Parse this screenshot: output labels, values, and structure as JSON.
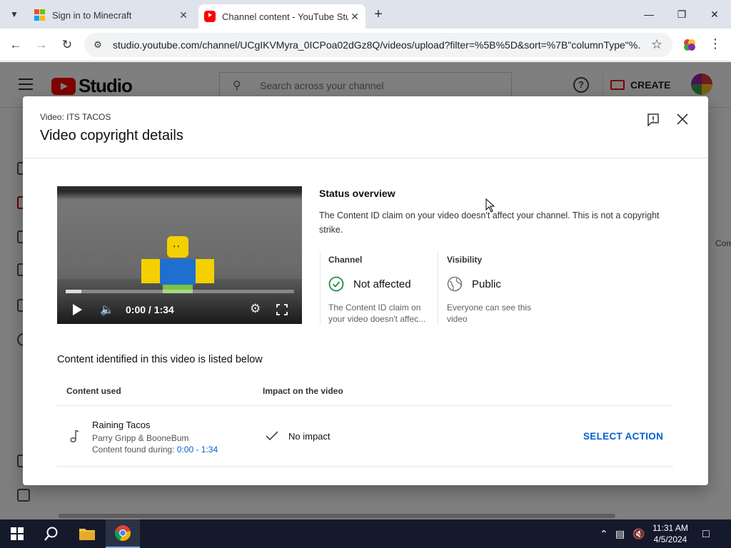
{
  "browser": {
    "tabs": [
      {
        "title": "Sign in to Minecraft",
        "active": false
      },
      {
        "title": "Channel content - YouTube Studio",
        "active": true
      }
    ],
    "url": "studio.youtube.com/channel/UCgIKVMyra_0ICPoa02dGz8Q/videos/upload?filter=%5B%5D&sort=%7B\"columnType\"%..."
  },
  "studio": {
    "logo_text": "Studio",
    "search_placeholder": "Search across your channel",
    "create_label": "CREATE",
    "partial_text": "Com"
  },
  "dialog": {
    "video_label": "Video: ITS TACOS",
    "title": "Video copyright details",
    "player": {
      "time": "0:00 / 1:34",
      "progress_fraction": 0.07
    },
    "status": {
      "title": "Status overview",
      "description": "The Content ID claim on your video doesn't affect your channel. This is not a copyright strike.",
      "channel": {
        "heading": "Channel",
        "value": "Not affected",
        "note": "The Content ID claim on your video doesn't affec..."
      },
      "visibility": {
        "heading": "Visibility",
        "value": "Public",
        "note": "Everyone can see this video"
      }
    },
    "content": {
      "heading": "Content identified in this video is listed below",
      "columns": [
        "Content used",
        "Impact on the video"
      ],
      "rows": [
        {
          "title": "Raining Tacos",
          "artist": "Parry Gripp & BooneBum",
          "found_label": "Content found during:",
          "found_range": "0:00 - 1:34",
          "impact": "No impact",
          "action": "SELECT ACTION"
        }
      ]
    }
  },
  "taskbar": {
    "time": "11:31 AM",
    "date": "4/5/2024"
  },
  "colors": {
    "accent_blue": "#065fd4",
    "youtube_red": "#ff0000",
    "check_green": "#1e8e3e"
  }
}
